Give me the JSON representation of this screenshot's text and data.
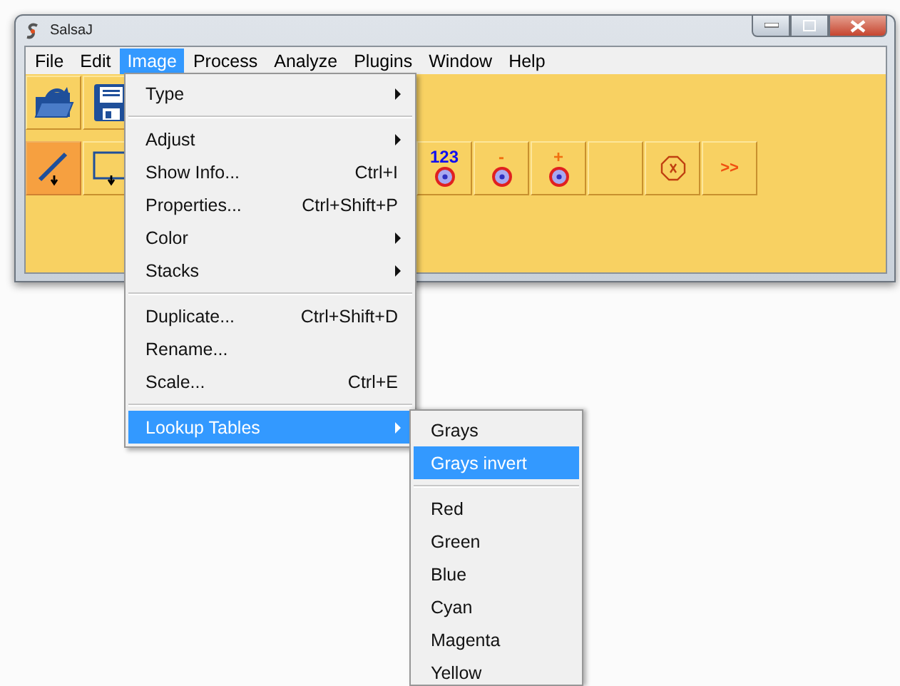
{
  "window": {
    "title": "SalsaJ"
  },
  "menu_bar": [
    {
      "label": "File",
      "selected": false
    },
    {
      "label": "Edit",
      "selected": false
    },
    {
      "label": "Image",
      "selected": true
    },
    {
      "label": "Process",
      "selected": false
    },
    {
      "label": "Analyze",
      "selected": false
    },
    {
      "label": "Plugins",
      "selected": false
    },
    {
      "label": "Window",
      "selected": false
    },
    {
      "label": "Help",
      "selected": false
    }
  ],
  "toolbar_rows": [
    [
      {
        "kind": "open"
      },
      {
        "kind": "save"
      }
    ],
    [
      {
        "kind": "line",
        "selected": true
      },
      {
        "kind": "rect",
        "selected": false
      },
      {
        "kind": "gap"
      },
      {
        "kind": "count",
        "label": "123"
      },
      {
        "kind": "minus",
        "label": "-"
      },
      {
        "kind": "plus",
        "label": "+"
      },
      {
        "kind": "blank"
      },
      {
        "kind": "stop"
      },
      {
        "kind": "more",
        "label": ">>"
      }
    ]
  ],
  "image_menu": {
    "items": [
      {
        "kind": "item",
        "label": "Type",
        "has_submenu": true,
        "selected": false
      },
      {
        "kind": "separator"
      },
      {
        "kind": "item",
        "label": "Adjust",
        "has_submenu": true,
        "selected": false
      },
      {
        "kind": "item",
        "label": "Show Info...",
        "shortcut": "Ctrl+I",
        "selected": false
      },
      {
        "kind": "item",
        "label": "Properties...",
        "shortcut": "Ctrl+Shift+P",
        "selected": false
      },
      {
        "kind": "item",
        "label": "Color",
        "has_submenu": true,
        "selected": false
      },
      {
        "kind": "item",
        "label": "Stacks",
        "has_submenu": true,
        "selected": false
      },
      {
        "kind": "separator"
      },
      {
        "kind": "item",
        "label": "Duplicate...",
        "shortcut": "Ctrl+Shift+D",
        "selected": false
      },
      {
        "kind": "item",
        "label": "Rename...",
        "selected": false
      },
      {
        "kind": "item",
        "label": "Scale...",
        "shortcut": "Ctrl+E",
        "selected": false
      },
      {
        "kind": "separator"
      },
      {
        "kind": "item",
        "label": "Lookup Tables",
        "has_submenu": true,
        "selected": true
      }
    ]
  },
  "lookup_tables_menu": {
    "items": [
      {
        "kind": "item",
        "label": "Grays",
        "selected": false
      },
      {
        "kind": "item",
        "label": "Grays invert",
        "selected": true
      },
      {
        "kind": "separator"
      },
      {
        "kind": "item",
        "label": "Red",
        "selected": false
      },
      {
        "kind": "item",
        "label": "Green",
        "selected": false
      },
      {
        "kind": "item",
        "label": "Blue",
        "selected": false
      },
      {
        "kind": "item",
        "label": "Cyan",
        "selected": false
      },
      {
        "kind": "item",
        "label": "Magenta",
        "selected": false
      },
      {
        "kind": "item",
        "label": "Yellow",
        "selected": false
      }
    ]
  }
}
